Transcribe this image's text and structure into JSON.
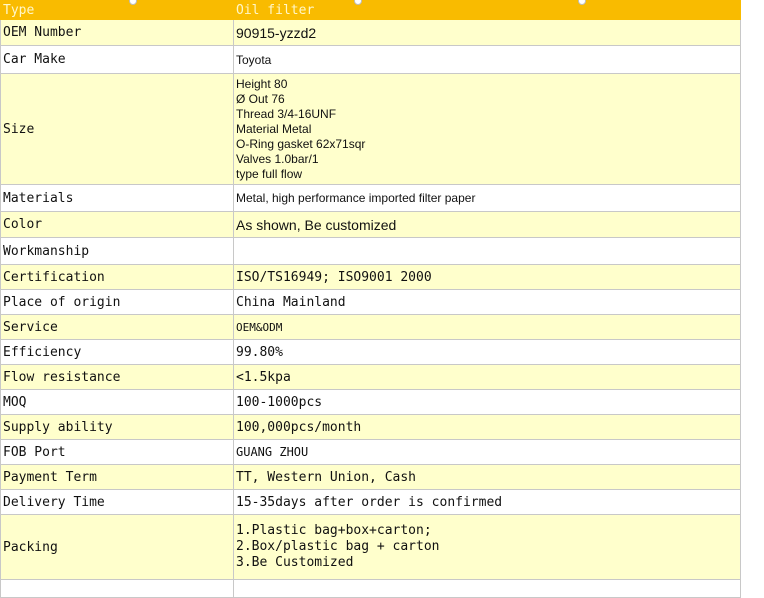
{
  "header": {
    "key": "Type",
    "value": "Oil filter"
  },
  "rows": [
    {
      "key": "OEM Number",
      "value": "90915-yzzd2"
    },
    {
      "key": "Car Make",
      "value": "Toyota"
    },
    {
      "key": "Size",
      "lines": [
        "Height 80",
        "Ø Out 76",
        "Thread 3/4-16UNF",
        "Material Metal",
        "O-Ring gasket 62x71sqr",
        "Valves 1.0bar/1",
        "type full flow"
      ]
    },
    {
      "key": "Materials",
      "value": "Metal, high performance imported filter paper"
    },
    {
      "key": "Color",
      "value": "As shown, Be customized"
    },
    {
      "key": "Workmanship",
      "value": ""
    },
    {
      "key": "Certification",
      "value": "ISO/TS16949; ISO9001 2000"
    },
    {
      "key": "Place of origin",
      "value": "China Mainland"
    },
    {
      "key": "Service",
      "value": "OEM&ODM"
    },
    {
      "key": "Efficiency",
      "value": "99.80%"
    },
    {
      "key": "Flow resistance",
      "value": "<1.5kpa"
    },
    {
      "key": "MOQ",
      "value": "100-1000pcs"
    },
    {
      "key": "Supply ability",
      "value": "100,000pcs/month"
    },
    {
      "key": "FOB Port",
      "value": "GUANG ZHOU"
    },
    {
      "key": "Payment Term",
      "value": "TT, Western Union, Cash"
    },
    {
      "key": "Delivery Time",
      "value": "15-35days after order is confirmed"
    },
    {
      "key": "Packing",
      "lines": [
        "1.Plastic bag+box+carton;",
        "2.Box/plastic bag + carton",
        "3.Be Customized"
      ]
    },
    {
      "key": "",
      "value": ""
    }
  ]
}
